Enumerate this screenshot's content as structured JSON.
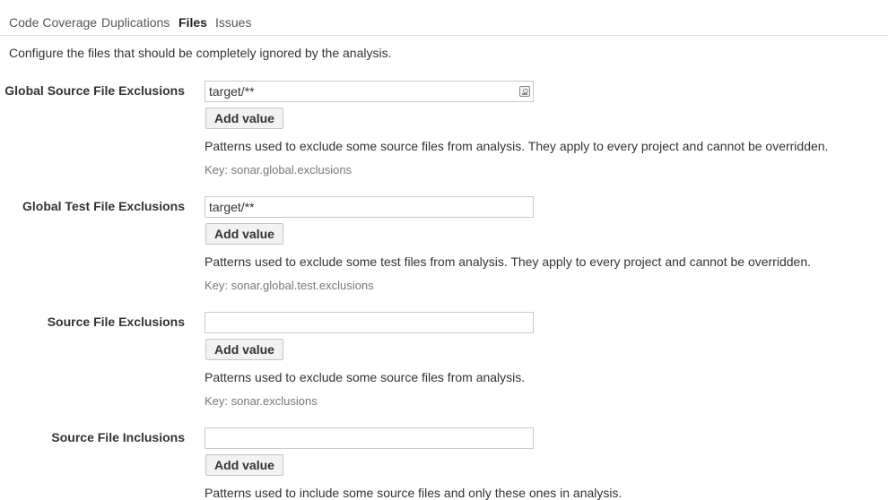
{
  "tabs": [
    {
      "label": "Code Coverage",
      "active": false
    },
    {
      "label": "Duplications",
      "active": false
    },
    {
      "label": "Files",
      "active": true
    },
    {
      "label": "Issues",
      "active": false
    }
  ],
  "intro": "Configure the files that should be completely ignored by the analysis.",
  "add_value_label": "Add value",
  "properties": [
    {
      "label": "Global Source File Exclusions",
      "value": "target/**",
      "description": "Patterns used to exclude some source files from analysis. They apply to every project and cannot be overridden.",
      "key": "Key: sonar.global.exclusions",
      "field_icon": "contact-card-icon"
    },
    {
      "label": "Global Test File Exclusions",
      "value": "target/**",
      "description": "Patterns used to exclude some test files from analysis. They apply to every project and cannot be overridden.",
      "key": "Key: sonar.global.test.exclusions"
    },
    {
      "label": "Source File Exclusions",
      "value": "",
      "description": "Patterns used to exclude some source files from analysis.",
      "key": "Key: sonar.exclusions"
    },
    {
      "label": "Source File Inclusions",
      "value": "",
      "description": "Patterns used to include some source files and only these ones in analysis."
    }
  ]
}
